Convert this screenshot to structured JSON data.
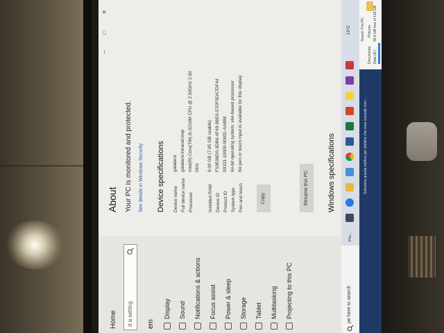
{
  "settings": {
    "sidebar": {
      "home": "Home",
      "search_placeholder": "d a setting",
      "section": "em",
      "items": [
        "Display",
        "Sound",
        "Notifications & actions",
        "Focus assist",
        "Power & sleep",
        "Storage",
        "Tablet",
        "Multitasking",
        "Projecting to this PC"
      ]
    },
    "main": {
      "title": "About",
      "status": "Your PC is monitored and protected.",
      "security_link": "See details in Windows Security",
      "spec_title": "Device specifications",
      "specs": [
        {
          "key": "Device name",
          "value": "gaiabeni"
        },
        {
          "key": "Full device name",
          "value": "gaiabeni.intranet.trep"
        },
        {
          "key": "Processor",
          "value": "Intel(R) Core(TM) i5-3210M CPU @ 2.50GHz 2.50 GHz"
        },
        {
          "key": "Installed RAM",
          "value": "8.00 GB (7.85 GB usable)"
        },
        {
          "key": "Device ID",
          "value": "F10E08D0-3DB6-4F49-9BE0-57DF0DA7DF44"
        },
        {
          "key": "Product ID",
          "value": "00331-10000-00001-AA898"
        },
        {
          "key": "System type",
          "value": "64-bit operating system, x64-based processor"
        },
        {
          "key": "Pen and touch",
          "value": "No pen or touch input is available for this display"
        }
      ],
      "copy_label": "Copy",
      "rename_label": "Rename this PC",
      "windows_spec_title": "Windows specifications"
    },
    "window_controls": {
      "minimize": "–",
      "maximize": "□",
      "close": "✕"
    }
  },
  "explorer": {
    "search_placeholder": "Search This PC",
    "items": [
      "Documents",
      "Pictures"
    ],
    "drive_label": "Data (D:)",
    "drive_free": "55.8 GB free of 118 GB"
  },
  "wallpaper": {
    "notification": "Seleziona questa notifica per stabilire che cosa succede con i..."
  },
  "taskbar": {
    "search_text": "pe here to search",
    "pinned_label": "Pro...",
    "tray_text": "19°C"
  },
  "colors": {
    "link": "#2563a8",
    "wallpaper": "#1f3a66",
    "taskbar": "#d8dde6",
    "drive_bar": "#2a7bd4"
  }
}
